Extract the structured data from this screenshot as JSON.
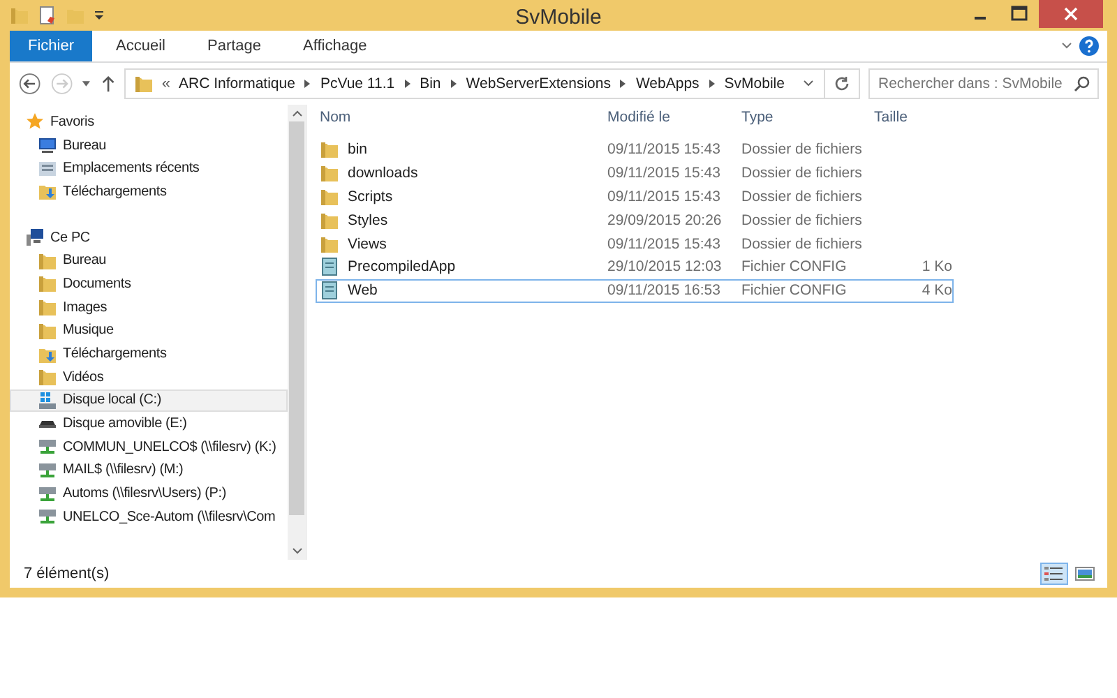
{
  "window": {
    "title": "SvMobile"
  },
  "ribbon_tabs": [
    {
      "label": "Fichier",
      "selected": true
    },
    {
      "label": "Accueil",
      "selected": false
    },
    {
      "label": "Partage",
      "selected": false
    },
    {
      "label": "Affichage",
      "selected": false
    }
  ],
  "address_bar": {
    "overflow": "«",
    "segments": [
      "ARC Informatique",
      "PcVue 11.1",
      "Bin",
      "WebServerExtensions",
      "WebApps",
      "SvMobile"
    ]
  },
  "search": {
    "placeholder": "Rechercher dans : SvMobile"
  },
  "sidebar": {
    "items": [
      {
        "label": "Favoris",
        "kind": "favorites",
        "selected": false,
        "children": [
          {
            "label": "Bureau",
            "kind": "desktop",
            "selected": false
          },
          {
            "label": "Emplacements récents",
            "kind": "recent",
            "selected": false
          },
          {
            "label": "Téléchargements",
            "kind": "downloads",
            "selected": false
          }
        ]
      },
      {
        "label": "Ce PC",
        "kind": "pc",
        "selected": false,
        "children": [
          {
            "label": "Bureau",
            "kind": "folder",
            "selected": false
          },
          {
            "label": "Documents",
            "kind": "folder",
            "selected": false
          },
          {
            "label": "Images",
            "kind": "folder",
            "selected": false
          },
          {
            "label": "Musique",
            "kind": "folder",
            "selected": false
          },
          {
            "label": "Téléchargements",
            "kind": "downloads",
            "selected": false
          },
          {
            "label": "Vidéos",
            "kind": "folder",
            "selected": false
          },
          {
            "label": "Disque local (C:)",
            "kind": "drive",
            "selected": true
          },
          {
            "label": "Disque amovible (E:)",
            "kind": "removable",
            "selected": false
          },
          {
            "label": "COMMUN_UNELCO$ (\\\\filesrv) (K:)",
            "kind": "network",
            "selected": false
          },
          {
            "label": "MAIL$ (\\\\filesrv) (M:)",
            "kind": "network",
            "selected": false
          },
          {
            "label": "Automs (\\\\filesrv\\Users) (P:)",
            "kind": "network",
            "selected": false
          },
          {
            "label": "UNELCO_Sce-Autom (\\\\filesrv\\Com",
            "kind": "network",
            "selected": false
          }
        ]
      }
    ]
  },
  "table": {
    "columns": [
      "Nom",
      "Modifié le",
      "Type",
      "Taille"
    ],
    "rows": [
      {
        "name": "bin",
        "modified": "09/11/2015 15:43",
        "type": "Dossier de fichiers",
        "kind": "folder",
        "selected": false
      },
      {
        "name": "downloads",
        "modified": "09/11/2015 15:43",
        "type": "Dossier de fichiers",
        "kind": "folder",
        "selected": false
      },
      {
        "name": "Scripts",
        "modified": "09/11/2015 15:43",
        "type": "Dossier de fichiers",
        "kind": "folder",
        "selected": false
      },
      {
        "name": "Styles",
        "modified": "29/09/2015 20:26",
        "type": "Dossier de fichiers",
        "kind": "folder",
        "selected": false
      },
      {
        "name": "Views",
        "modified": "09/11/2015 15:43",
        "type": "Dossier de fichiers",
        "kind": "folder",
        "selected": false
      },
      {
        "name": "PrecompiledApp",
        "modified": "29/10/2015 12:03",
        "type": "Fichier CONFIG",
        "size": "1 Ko",
        "kind": "config",
        "selected": false
      },
      {
        "name": "Web",
        "modified": "09/11/2015 16:53",
        "type": "Fichier CONFIG",
        "size": "4 Ko",
        "kind": "config",
        "selected": true
      }
    ]
  },
  "status_bar": {
    "text": "7 élément(s)"
  },
  "view_buttons": [
    {
      "kind": "details",
      "selected": true
    },
    {
      "kind": "tiles",
      "selected": false
    }
  ]
}
